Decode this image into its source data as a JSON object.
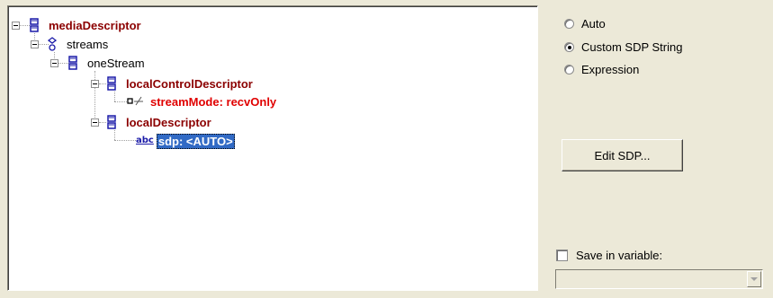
{
  "tree": {
    "nodes": [
      {
        "label": "mediaDescriptor",
        "icon": "struct-icon"
      },
      {
        "label": "streams",
        "icon": "sequence-icon"
      },
      {
        "label": "oneStream",
        "icon": "struct-icon"
      },
      {
        "label": "localControlDescriptor",
        "icon": "struct-icon"
      },
      {
        "label": "streamMode: recvOnly",
        "icon": "enum-icon"
      },
      {
        "label": "localDescriptor",
        "icon": "struct-icon"
      },
      {
        "label": "sdp: <AUTO>",
        "icon": "string-icon",
        "icon_text": "abc"
      }
    ]
  },
  "options": {
    "radios": [
      {
        "label": "Auto",
        "checked": false
      },
      {
        "label": "Custom SDP String",
        "checked": true
      },
      {
        "label": "Expression",
        "checked": false
      }
    ],
    "edit_button": "Edit SDP...",
    "save_checkbox_label": "Save in variable:",
    "variable_value": ""
  },
  "colors": {
    "struct_icon": "#1a1aa8",
    "label_dark_red": "#8b0000",
    "label_red": "#e00000",
    "selection": "#316ac5"
  }
}
